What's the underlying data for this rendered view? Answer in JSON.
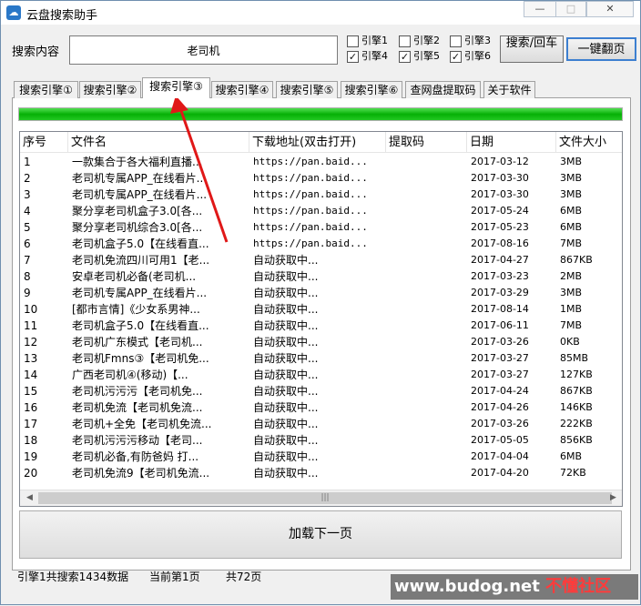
{
  "window": {
    "title": "云盘搜索助手",
    "min_glyph": "—",
    "max_glyph": "□",
    "close_glyph": "✕"
  },
  "search": {
    "label": "搜索内容",
    "value": "老司机",
    "checkboxes": [
      {
        "label": "引擎1",
        "checked": false
      },
      {
        "label": "引擎2",
        "checked": false
      },
      {
        "label": "引擎3",
        "checked": false
      },
      {
        "label": "引擎4",
        "checked": true
      },
      {
        "label": "引擎5",
        "checked": true
      },
      {
        "label": "引擎6",
        "checked": true
      }
    ],
    "search_button": "搜索/回车",
    "flip_button": "一键翻页"
  },
  "tabs": [
    {
      "label": "搜索引擎①",
      "active": false
    },
    {
      "label": "搜索引擎②",
      "active": false
    },
    {
      "label": "搜索引擎③",
      "active": true
    },
    {
      "label": "搜索引擎④",
      "active": false
    },
    {
      "label": "搜索引擎⑤",
      "active": false
    },
    {
      "label": "搜索引擎⑥",
      "active": false
    },
    {
      "label": "查网盘提取码",
      "active": false
    },
    {
      "label": "关于软件",
      "active": false
    }
  ],
  "progress": {
    "value": 1.0,
    "color": "#06b006"
  },
  "table": {
    "columns": [
      "序号",
      "文件名",
      "下载地址(双击打开)",
      "提取码",
      "日期",
      "文件大小"
    ],
    "rows": [
      [
        "1",
        "一款集合于各大福利直播...",
        "https://pan.baid...",
        "",
        "2017-03-12",
        "3MB"
      ],
      [
        "2",
        "老司机专属APP_在线看片...",
        "https://pan.baid...",
        "",
        "2017-03-30",
        "3MB"
      ],
      [
        "3",
        "老司机专属APP_在线看片...",
        "https://pan.baid...",
        "",
        "2017-03-30",
        "3MB"
      ],
      [
        "4",
        "聚分享老司机盒子3.0[各...",
        "https://pan.baid...",
        "",
        "2017-05-24",
        "6MB"
      ],
      [
        "5",
        "聚分享老司机综合3.0[各...",
        "https://pan.baid...",
        "",
        "2017-05-23",
        "6MB"
      ],
      [
        "6",
        "老司机盒子5.0【在线看直...",
        "https://pan.baid...",
        "",
        "2017-08-16",
        "7MB"
      ],
      [
        "7",
        "老司机免流四川可用1【老...",
        "自动获取中...",
        "",
        "2017-04-27",
        "867KB"
      ],
      [
        "8",
        "安卓老司机必备(老司机...",
        "自动获取中...",
        "",
        "2017-03-23",
        "2MB"
      ],
      [
        "9",
        "老司机专属APP_在线看片...",
        "自动获取中...",
        "",
        "2017-03-29",
        "3MB"
      ],
      [
        "10",
        "[都市言情]《少女系男神...",
        "自动获取中...",
        "",
        "2017-08-14",
        "1MB"
      ],
      [
        "11",
        "老司机盒子5.0【在线看直...",
        "自动获取中...",
        "",
        "2017-06-11",
        "7MB"
      ],
      [
        "12",
        "老司机广东模式【老司机...",
        "自动获取中...",
        "",
        "2017-03-26",
        "0KB"
      ],
      [
        "13",
        "老司机Fmns③【老司机免...",
        "自动获取中...",
        "",
        "2017-03-27",
        "85MB"
      ],
      [
        "14",
        "广西老司机④(移动)【...",
        "自动获取中...",
        "",
        "2017-03-27",
        "127KB"
      ],
      [
        "15",
        "老司机污污污【老司机免...",
        "自动获取中...",
        "",
        "2017-04-24",
        "867KB"
      ],
      [
        "16",
        "老司机免流【老司机免流...",
        "自动获取中...",
        "",
        "2017-04-26",
        "146KB"
      ],
      [
        "17",
        "老司机+全免【老司机免流...",
        "自动获取中...",
        "",
        "2017-03-26",
        "222KB"
      ],
      [
        "18",
        "老司机污污污移动【老司...",
        "自动获取中...",
        "",
        "2017-05-05",
        "856KB"
      ],
      [
        "19",
        "老司机必备,有防爸妈 打...",
        "自动获取中...",
        "",
        "2017-04-04",
        "6MB"
      ],
      [
        "20",
        "老司机免流9【老司机免流...",
        "自动获取中...",
        "",
        "2017-04-20",
        "72KB"
      ]
    ]
  },
  "scroll": {
    "left_glyph": "◀",
    "right_glyph": "▶",
    "thumb_glyph": "|||"
  },
  "load_more_button": "加载下一页",
  "status": {
    "engine_summary": "引擎1共搜索1434数据",
    "current_page": "当前第1页",
    "total_pages": "共72页"
  },
  "watermark": {
    "part1": "www.budog.net",
    "part2": " 不懂社区"
  },
  "annotation_color": "#e01818"
}
